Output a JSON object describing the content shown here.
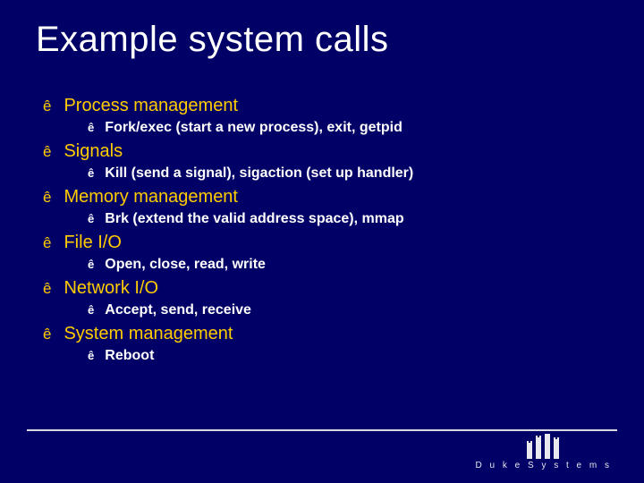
{
  "slide": {
    "title": "Example system calls",
    "bullet_glyph": "ê",
    "items": [
      {
        "label": "Process management",
        "sub": "Fork/exec (start a new process), exit, getpid"
      },
      {
        "label": "Signals",
        "sub": "Kill (send a signal), sigaction (set up handler)"
      },
      {
        "label": "Memory management",
        "sub": "Brk (extend the valid address space), mmap"
      },
      {
        "label": "File I/O",
        "sub": "Open, close, read, write"
      },
      {
        "label": "Network I/O",
        "sub": "Accept, send, receive"
      },
      {
        "label": "System management",
        "sub": "Reboot"
      }
    ]
  },
  "footer": {
    "brand": "D u k e S y s t e m s"
  }
}
